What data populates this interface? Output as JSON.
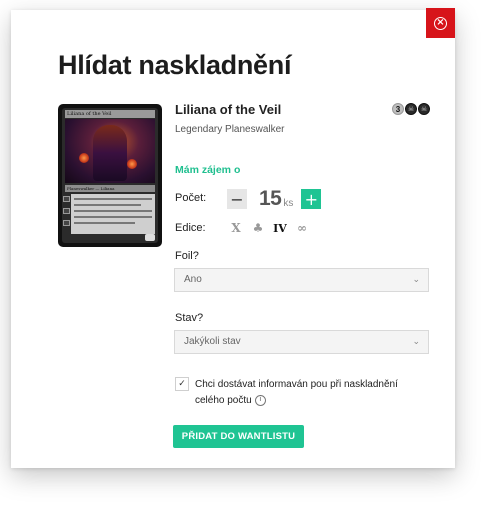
{
  "colors": {
    "accent": "#1fc493",
    "close": "#d7141a"
  },
  "modal": {
    "title": "Hlídat naskladnění",
    "close_icon": "close-circle-icon"
  },
  "card": {
    "name": "Liliana of the Veil",
    "type_line": "Legendary Planeswalker",
    "image": {
      "name_bar": "Liliana of the Veil",
      "type_bar": "Planeswalker — Liliana"
    },
    "mana_cost": [
      "3",
      "black",
      "black"
    ]
  },
  "form": {
    "section_heading": "Mám zájem o",
    "quantity_label": "Počet:",
    "quantity_value": "15",
    "quantity_unit": "ks",
    "minus_label": "−",
    "plus_label": "+",
    "edition_label": "Edice:",
    "editions": [
      {
        "icon": "edition-x-icon",
        "glyph": "X",
        "active": false
      },
      {
        "icon": "edition-tree-icon",
        "glyph": "♣",
        "active": false
      },
      {
        "icon": "edition-iv-icon",
        "glyph": "IV",
        "active": true
      },
      {
        "icon": "edition-glasses-icon",
        "glyph": "∞",
        "active": false
      }
    ],
    "foil_label": "Foil?",
    "foil_value": "Ano",
    "condition_label": "Stav?",
    "condition_value": "Jakýkoli stav",
    "notify_checked": true,
    "notify_text": "Chci dostávat informaván pou při naskladnění celého počtu",
    "submit_label": "PŘIDAT DO WANTLISTU"
  }
}
